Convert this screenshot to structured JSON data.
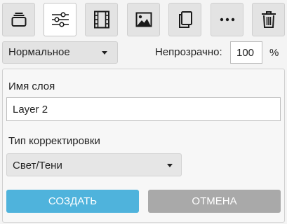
{
  "toolbar": {
    "buttons": [
      {
        "icon": "layers-icon",
        "active": false
      },
      {
        "icon": "sliders-icon",
        "active": true
      },
      {
        "icon": "film-icon",
        "active": false
      },
      {
        "icon": "image-icon",
        "active": false
      },
      {
        "icon": "duplicate-icon",
        "active": false
      },
      {
        "icon": "more-icon",
        "active": false
      },
      {
        "icon": "trash-icon",
        "active": false
      }
    ]
  },
  "blend_mode": {
    "value": "Нормальное"
  },
  "opacity": {
    "label": "Непрозрачно:",
    "value": "100",
    "unit": "%"
  },
  "layer_name": {
    "label": "Имя слоя",
    "value": "Layer 2"
  },
  "adjustment_type": {
    "label": "Тип корректировки",
    "value": "Свет/Тени"
  },
  "actions": {
    "create_label": "СОЗДАТЬ",
    "cancel_label": "ОТМЕНА"
  },
  "colors": {
    "accent": "#4fb3dc",
    "cancel": "#a9a9a9"
  }
}
